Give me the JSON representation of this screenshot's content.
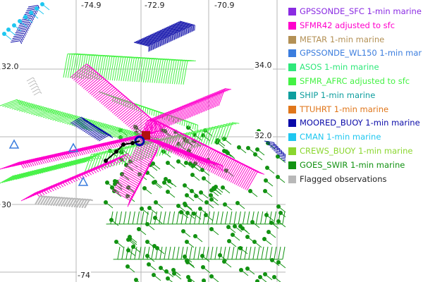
{
  "map": {
    "grid_labels": [
      {
        "text": "-74.9"
      },
      {
        "text": "-72.9"
      },
      {
        "text": "-70.9"
      },
      {
        "text": "34.0"
      },
      {
        "text": "32.0"
      },
      {
        "text": "32.0"
      },
      {
        "text": "30"
      },
      {
        "text": "-74"
      }
    ]
  },
  "legend": {
    "items": [
      {
        "label": "GPSSONDE_SFC 1-min marine",
        "color": "#8a2be2",
        "text_color": "#8a2be2"
      },
      {
        "label": "SFMR42 adjusted to sfc",
        "color": "#ff00cc",
        "text_color": "#ff00cc"
      },
      {
        "label": "METAR 1-min marine",
        "color": "#b39055",
        "text_color": "#b39055"
      },
      {
        "label": "GPSSONDE_WL150 1-min mar",
        "color": "#3b7dde",
        "text_color": "#3b7dde"
      },
      {
        "label": "ASOS 1-min marine",
        "color": "#2ee87a",
        "text_color": "#2ee87a"
      },
      {
        "label": "SFMR_AFRC adjusted to sfc",
        "color": "#44f244",
        "text_color": "#44f244"
      },
      {
        "label": "SHIP 1-min marine",
        "color": "#0e9e9e",
        "text_color": "#0e9e9e"
      },
      {
        "label": "TTUHRT 1-min marine",
        "color": "#e0761a",
        "text_color": "#e0761a"
      },
      {
        "label": "MOORED_BUOY 1-min marine",
        "color": "#0a0aa8",
        "text_color": "#0a0aa8"
      },
      {
        "label": "CMAN 1-min marine",
        "color": "#1fc7f0",
        "text_color": "#1fc7f0"
      },
      {
        "label": "CREWS_BUOY 1-min marine",
        "color": "#8ad62e",
        "text_color": "#8ad62e"
      },
      {
        "label": "GOES_SWIR 1-min marine",
        "color": "#129212",
        "text_color": "#129212"
      },
      {
        "label": "Flagged observations",
        "color": "#b8b8b8",
        "text_color": "#222222"
      }
    ]
  }
}
